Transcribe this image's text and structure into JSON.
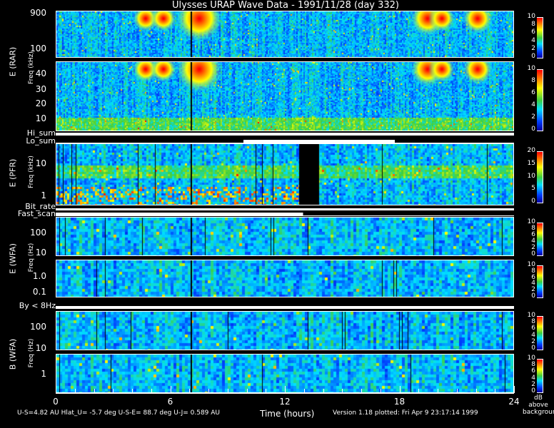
{
  "title": "Ulysses URAP Wave Data - 1991/11/28  (day 332)",
  "footer": {
    "ephemeris": "U-S=4.82 AU  Hlat_U= -5.7 deg  U-S-E= 88.7 deg  U-J= 0.589 AU",
    "xlabel": "Time (hours)",
    "version": "Version 1.18 plotted: Fri Apr  9 23:17:14 1999",
    "units": [
      "dB",
      "above",
      "background"
    ]
  },
  "flags": {
    "hi_sum": "Hi_sum",
    "lo_sum": "Lo_sum",
    "bit_rate": "Bit_rate",
    "fast_scan": "Fast_scan",
    "by": "By < 8Hz"
  },
  "group_labels": {
    "rar": "E (RAR)",
    "pfr": "E (PFR)",
    "wfa_e": "E (WFA)",
    "wfa_b": "B (WFA)",
    "freq_khz": "Freq (kHz)",
    "freq_hz": "Freq (Hz)"
  },
  "chart_data": {
    "type": "heatmap",
    "title": "Ulysses URAP Wave Data - 1991/11/28  (day 332)",
    "xlabel": "Time (hours)",
    "xlim": [
      0,
      24
    ],
    "xticks": [
      "0",
      "6",
      "12",
      "18",
      "24"
    ],
    "panels": [
      {
        "name": "RAR high",
        "ylabel": "Freq (kHz)",
        "yticks": [
          "900",
          "100"
        ],
        "colorbar": {
          "range": [
            0,
            10
          ],
          "ticks": [
            "10",
            "8",
            "6",
            "4",
            "2",
            "0"
          ]
        }
      },
      {
        "name": "RAR low",
        "ylabel": "Freq (kHz)",
        "yticks": [
          "40",
          "30",
          "20",
          "10"
        ],
        "colorbar": {
          "range": [
            0,
            10
          ],
          "ticks": [
            "10",
            "8",
            "6",
            "4",
            "2",
            "0"
          ]
        }
      },
      {
        "name": "PFR",
        "ylabel": "Freq (kHz)",
        "yticks": [
          "10",
          "1"
        ],
        "colorbar": {
          "range": [
            0,
            20
          ],
          "ticks": [
            "20",
            "15",
            "10",
            "5",
            "0"
          ]
        }
      },
      {
        "name": "WFA E high",
        "ylabel": "Freq (Hz)",
        "yticks": [
          "100",
          "10"
        ],
        "colorbar": {
          "range": [
            0,
            10
          ],
          "ticks": [
            "10",
            "8",
            "6",
            "4",
            "2",
            "0"
          ]
        }
      },
      {
        "name": "WFA E low",
        "ylabel": "Freq (Hz)",
        "yticks": [
          "1.0",
          "0.1"
        ],
        "colorbar": {
          "range": [
            0,
            10
          ],
          "ticks": [
            "10",
            "8",
            "6",
            "4",
            "2",
            "0"
          ]
        }
      },
      {
        "name": "WFA B high",
        "ylabel": "Freq (Hz)",
        "yticks": [
          "100",
          "10"
        ],
        "colorbar": {
          "range": [
            0,
            10
          ],
          "ticks": [
            "10",
            "8",
            "6",
            "4",
            "2",
            "0"
          ]
        }
      },
      {
        "name": "WFA B low",
        "ylabel": "Freq (Hz)",
        "yticks": [
          "1"
        ],
        "colorbar": {
          "range": [
            0,
            10
          ],
          "ticks": [
            "10",
            "8",
            "6",
            "4",
            "2",
            "0"
          ]
        }
      }
    ],
    "colorbar_units": "dB above background"
  }
}
